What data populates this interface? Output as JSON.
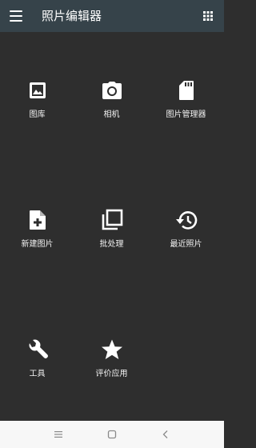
{
  "app_bar": {
    "title": "照片编辑器",
    "menu_icon": "hamburger-menu-icon",
    "apps_icon": "grid-apps-icon",
    "background_color": "#36434a"
  },
  "tiles": [
    {
      "label": "图库",
      "icon": "gallery-image-icon"
    },
    {
      "label": "相机",
      "icon": "camera-icon"
    },
    {
      "label": "图片管理器",
      "icon": "sd-card-icon"
    },
    {
      "label": "新建图片",
      "icon": "new-file-icon"
    },
    {
      "label": "批处理",
      "icon": "batch-copy-icon"
    },
    {
      "label": "最近照片",
      "icon": "history-icon"
    },
    {
      "label": "工具",
      "icon": "wrench-icon"
    },
    {
      "label": "评价应用",
      "icon": "star-icon"
    }
  ],
  "nav_bar": {
    "menu_icon": "nav-menu-icon",
    "home_icon": "nav-home-icon",
    "back_icon": "nav-back-icon"
  },
  "colors": {
    "background": "#2e2e2e",
    "icon": "#ffffff",
    "nav_bar": "#f7f7f7"
  }
}
